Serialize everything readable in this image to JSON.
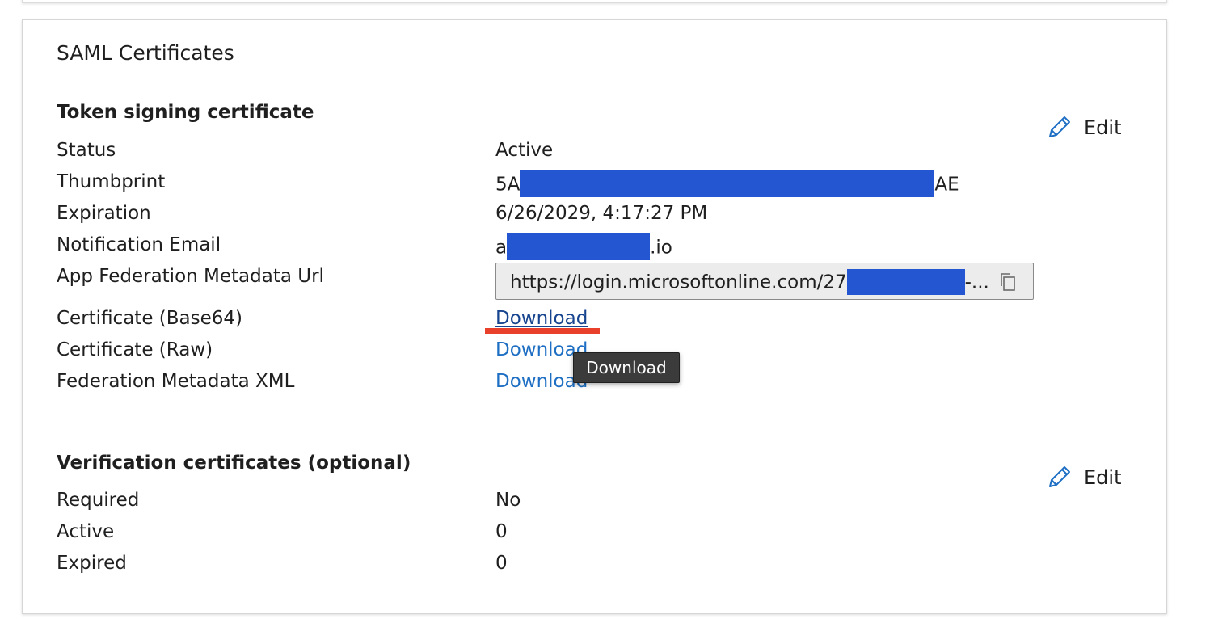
{
  "card": {
    "title": "SAML Certificates"
  },
  "token_signing": {
    "title": "Token signing certificate",
    "edit_label": "Edit",
    "status_label": "Status",
    "status_value": "Active",
    "thumbprint_label": "Thumbprint",
    "thumbprint_prefix": "5A",
    "thumbprint_suffix": "AE",
    "expiration_label": "Expiration",
    "expiration_value": "6/26/2029, 4:17:27 PM",
    "notification_email_label": "Notification Email",
    "notification_email_prefix": "a",
    "notification_email_suffix": ".io",
    "metadata_url_label": "App Federation Metadata Url",
    "metadata_url_prefix": "https://login.microsoftonline.com/27",
    "metadata_url_suffix": "-...",
    "cert_base64_label": "Certificate (Base64)",
    "cert_base64_link": "Download",
    "cert_raw_label": "Certificate (Raw)",
    "cert_raw_link": "Download",
    "fed_xml_label": "Federation Metadata XML",
    "fed_xml_link": "Download",
    "tooltip": "Download"
  },
  "verification": {
    "title": "Verification certificates (optional)",
    "edit_label": "Edit",
    "required_label": "Required",
    "required_value": "No",
    "active_label": "Active",
    "active_value": "0",
    "expired_label": "Expired",
    "expired_value": "0"
  },
  "colors": {
    "link": "#1e6fc4",
    "link_active": "#17448f",
    "redaction": "#2356d0",
    "annotation_underline": "#e8402a"
  },
  "icons": {
    "edit": "pencil-icon",
    "copy": "copy-icon"
  }
}
